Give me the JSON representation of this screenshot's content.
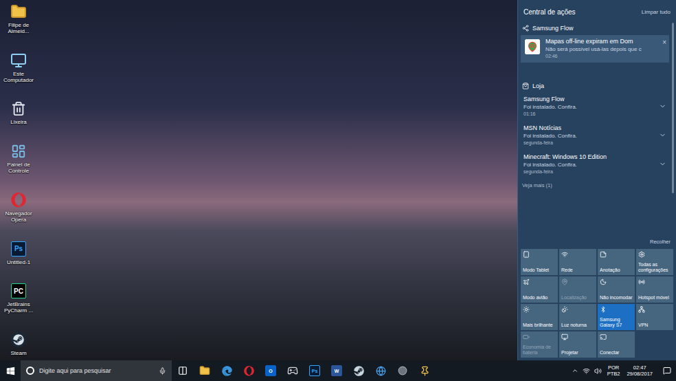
{
  "desktop": {
    "icons": [
      {
        "label": "Filipe de Almeid...",
        "kind": "user"
      },
      {
        "label": "Este Computador",
        "kind": "computer"
      },
      {
        "label": "Lixeira",
        "kind": "recycle"
      },
      {
        "label": "Painel de Controle",
        "kind": "control"
      },
      {
        "label": "Navegador Opera",
        "kind": "opera"
      },
      {
        "label": "Untitled-1",
        "kind": "photoshop",
        "badge": "Ps"
      },
      {
        "label": "JetBrains PyCharm ...",
        "kind": "pycharm",
        "badge": "PC"
      },
      {
        "label": "Steam",
        "kind": "steam"
      }
    ]
  },
  "action_center": {
    "title": "Central de ações",
    "clear_all": "Limpar tudo",
    "groups": [
      {
        "app": "Samsung Flow",
        "kind": "samsung",
        "notifications": [
          {
            "title": "Mapas off-line expiram em Dom",
            "body": "Não será possível usá-las depois que c",
            "time": "02:46",
            "kind": "maps",
            "dismiss": "×"
          }
        ]
      },
      {
        "app": "Loja",
        "kind": "store",
        "notifications": [
          {
            "title": "Samsung Flow",
            "body": "Foi instalado. Confira.",
            "time": "01:16",
            "kind": "plain"
          },
          {
            "title": "MSN Notícias",
            "body": "Foi instalado. Confira.",
            "time": "segunda-feira",
            "kind": "plain"
          },
          {
            "title": "Minecraft: Windows 10 Edition",
            "body": "Foi instalado. Confira.",
            "time": "segunda-feira",
            "kind": "plain"
          }
        ]
      }
    ],
    "see_more": "Veja mais (1)",
    "collapse": "Recolher",
    "quick_actions": [
      {
        "label": "Modo Tablet",
        "kind": "tablet",
        "on": false,
        "disabled": false
      },
      {
        "label": "Rede",
        "kind": "network",
        "on": false,
        "disabled": false
      },
      {
        "label": "Anotação",
        "kind": "note",
        "on": false,
        "disabled": false
      },
      {
        "label": "Todas as configurações",
        "kind": "settings",
        "on": false,
        "disabled": false
      },
      {
        "label": "Modo avião",
        "kind": "airplane",
        "on": false,
        "disabled": false
      },
      {
        "label": "Localização",
        "kind": "location",
        "on": false,
        "disabled": true
      },
      {
        "label": "Não incomodar",
        "kind": "moon",
        "on": false,
        "disabled": false
      },
      {
        "label": "Hotspot móvel",
        "kind": "hotspot",
        "on": false,
        "disabled": false
      },
      {
        "label": "Mais brilhante",
        "kind": "brightness",
        "on": false,
        "disabled": false
      },
      {
        "label": "Luz noturna",
        "kind": "nightlight",
        "on": false,
        "disabled": false
      },
      {
        "label": "Samsung Galaxy S7",
        "kind": "bluetooth",
        "on": true,
        "disabled": false
      },
      {
        "label": "VPN",
        "kind": "vpn",
        "on": false,
        "disabled": false
      },
      {
        "label": "Economia de bateria",
        "kind": "battery",
        "on": false,
        "disabled": true
      },
      {
        "label": "Projetar",
        "kind": "project",
        "on": false,
        "disabled": false
      },
      {
        "label": "Conectar",
        "kind": "connect",
        "on": false,
        "disabled": false
      }
    ]
  },
  "taskbar": {
    "search_placeholder": "Digite aqui para pesquisar",
    "apps": [
      {
        "kind": "taskview"
      },
      {
        "kind": "folder"
      },
      {
        "kind": "edge"
      },
      {
        "kind": "opera"
      },
      {
        "kind": "outlook",
        "badge": "O"
      },
      {
        "kind": "game"
      },
      {
        "kind": "photoshop",
        "badge": "Ps"
      },
      {
        "kind": "word",
        "badge": "W"
      },
      {
        "kind": "steam"
      },
      {
        "kind": "globe"
      },
      {
        "kind": "app"
      },
      {
        "kind": "pin"
      }
    ],
    "tray": {
      "language": "POR",
      "layout": "PTB2",
      "time": "02:47",
      "date": "29/08/2017"
    }
  }
}
